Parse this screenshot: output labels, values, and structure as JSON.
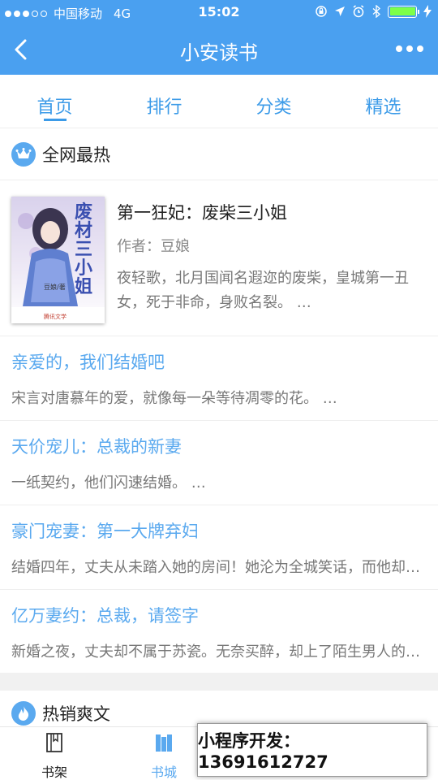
{
  "status_bar": {
    "carrier": "中国移动",
    "network": "4G",
    "time": "15:02"
  },
  "nav": {
    "title": "小安读书"
  },
  "tabs": [
    {
      "label": "首页",
      "active": true
    },
    {
      "label": "排行",
      "active": false
    },
    {
      "label": "分类",
      "active": false
    },
    {
      "label": "精选",
      "active": false
    }
  ],
  "sections": {
    "hot": {
      "title": "全网最热",
      "icon": "crown-icon"
    },
    "bestseller": {
      "title": "热销爽文",
      "icon": "flame-icon"
    }
  },
  "featured": {
    "title": "第一狂妃：废柴三小姐",
    "author": "作者：豆娘",
    "description": "夜轻歌，北月国闻名遐迩的废柴，皇城第一丑女，死于非命，身败名裂。 …",
    "cover": {
      "title_chars": "废材三小姐",
      "author_mark": "豆娘/著",
      "publisher": "腾讯文学"
    }
  },
  "books": [
    {
      "title": "亲爱的，我们结婚吧",
      "description": "宋言对唐慕年的爱，就像每一朵等待凋零的花。 …"
    },
    {
      "title": "天价宠儿：总裁的新妻",
      "description": "一纸契约，他们闪速结婚。 …"
    },
    {
      "title": "豪门宠妻：第一大牌弃妇",
      "description": "结婚四年，丈夫从未踏入她的房间！她沦为全城笑话，而他却在外面风流快活…"
    },
    {
      "title": "亿万妻约：总裁，请签字",
      "description": "新婚之夜，丈夫却不属于苏瓷。无奈买醉，却上了陌生男人的车…"
    }
  ],
  "tabbar": {
    "items": [
      {
        "label": "书架",
        "icon": "book-icon",
        "active": false
      },
      {
        "label": "书城",
        "icon": "bookstore-icon",
        "active": true
      }
    ]
  },
  "promo": {
    "text": "小程序开发：13691612727"
  },
  "colors": {
    "primary": "#4aa0f0",
    "link": "#5aa9ef",
    "battery": "#7dff4a"
  }
}
